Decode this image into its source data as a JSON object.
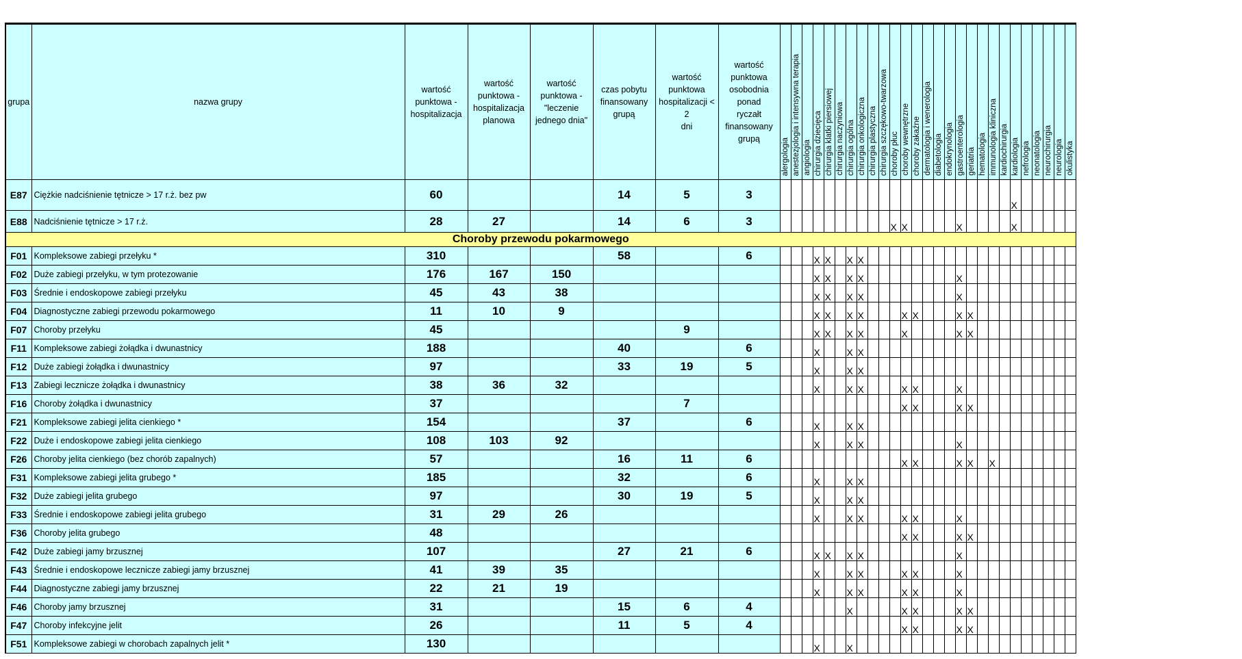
{
  "headers": {
    "code": "grupa",
    "name": "nazwa grupy",
    "values": [
      [
        "wartość",
        "punktowa -",
        "hospitalizacja"
      ],
      [
        "wartość",
        "punktowa -",
        "hospitalizacja",
        "planowa"
      ],
      [
        "wartość",
        "punktowa -",
        "\"leczenie",
        "jednego dnia\""
      ],
      [
        "czas pobytu",
        "finansowany",
        "grupą"
      ],
      [
        "wartość",
        "punktowa",
        "hospitalizacji < 2",
        "dni"
      ],
      [
        "wartość",
        "punktowa",
        "osobodnia ponad",
        "ryczałt",
        "finansowany",
        "grupą"
      ]
    ],
    "specialties": [
      "alergologia",
      "anestezjologia i intensywna terapia",
      "angiologia",
      "chirurgia dziecięca",
      "chirurgia klatki piersiowej",
      "chirurgia naczyniowa",
      "chirurgia ogólna",
      "chirurgia onkologiczna",
      "chirurgia plastyczna",
      "chirurgia szczękowo-twarzowa",
      "choroby płuc",
      "choroby wewnętrzne",
      "choroby zakaźne",
      "dermatologia i wenerologia",
      "diabetologia",
      "endokrynologia",
      "gastroenterologia",
      "geriatria",
      "hematologia",
      "immunologia kliniczna",
      "kardiochirurgia",
      "kardiologia",
      "nefrologia",
      "neonatologia",
      "neurochirurgia",
      "neurologia",
      "okulistyka"
    ]
  },
  "mark": "X",
  "rows": [
    {
      "code": "E87",
      "name": "Ciężkie nadciśnienie tętnicze > 17 r.ż. bez pw",
      "values": [
        "60",
        "",
        "",
        "14",
        "5",
        "3"
      ],
      "marks": [
        21
      ]
    },
    {
      "code": "E88",
      "name": "Nadciśnienie tętnicze > 17 r.ż.",
      "values": [
        "28",
        "27",
        "",
        "14",
        "6",
        "3"
      ],
      "marks": [
        10,
        11,
        16,
        21
      ]
    },
    {
      "section": "Choroby przewodu pokarmowego"
    },
    {
      "code": "F01",
      "name": "Kompleksowe zabiegi przełyku *",
      "values": [
        "310",
        "",
        "",
        "58",
        "",
        "6"
      ],
      "marks": [
        3,
        4,
        6,
        7
      ]
    },
    {
      "code": "F02",
      "name": "Duże zabiegi przełyku, w tym protezowanie",
      "values": [
        "176",
        "167",
        "150",
        "",
        "",
        ""
      ],
      "marks": [
        3,
        4,
        6,
        7,
        16
      ]
    },
    {
      "code": "F03",
      "name": "Średnie i endoskopowe zabiegi przełyku",
      "values": [
        "45",
        "43",
        "38",
        "",
        "",
        ""
      ],
      "marks": [
        3,
        4,
        6,
        7,
        16
      ]
    },
    {
      "code": "F04",
      "name": "Diagnostyczne zabiegi przewodu pokarmowego",
      "values": [
        "11",
        "10",
        "9",
        "",
        "",
        ""
      ],
      "marks": [
        3,
        4,
        6,
        7,
        11,
        12,
        16,
        17
      ]
    },
    {
      "code": "F07",
      "name": "Choroby przełyku",
      "values": [
        "45",
        "",
        "",
        "",
        "9",
        ""
      ],
      "marks": [
        3,
        4,
        6,
        7,
        11,
        16,
        17
      ]
    },
    {
      "code": "F11",
      "name": "Kompleksowe zabiegi żołądka i dwunastnicy",
      "values": [
        "188",
        "",
        "",
        "40",
        "",
        "6"
      ],
      "marks": [
        3,
        6,
        7
      ]
    },
    {
      "code": "F12",
      "name": "Duże zabiegi żołądka i dwunastnicy",
      "values": [
        "97",
        "",
        "",
        "33",
        "19",
        "5"
      ],
      "marks": [
        3,
        6,
        7
      ]
    },
    {
      "code": "F13",
      "name": "Zabiegi lecznicze żołądka i dwunastnicy",
      "values": [
        "38",
        "36",
        "32",
        "",
        "",
        ""
      ],
      "marks": [
        3,
        6,
        7,
        11,
        12,
        16
      ]
    },
    {
      "code": "F16",
      "name": "Choroby żołądka i dwunastnicy",
      "values": [
        "37",
        "",
        "",
        "",
        "7",
        ""
      ],
      "marks": [
        11,
        12,
        16,
        17
      ]
    },
    {
      "code": "F21",
      "name": "Kompleksowe zabiegi jelita cienkiego *",
      "values": [
        "154",
        "",
        "",
        "37",
        "",
        "6"
      ],
      "marks": [
        3,
        6,
        7
      ]
    },
    {
      "code": "F22",
      "name": "Duże i endoskopowe zabiegi jelita cienkiego",
      "values": [
        "108",
        "103",
        "92",
        "",
        "",
        ""
      ],
      "marks": [
        3,
        6,
        7,
        16
      ]
    },
    {
      "code": "F26",
      "name": "Choroby jelita cienkiego (bez chorób zapalnych)",
      "values": [
        "57",
        "",
        "",
        "16",
        "11",
        "6"
      ],
      "marks": [
        11,
        12,
        16,
        17,
        19
      ]
    },
    {
      "code": "F31",
      "name": "Kompleksowe zabiegi jelita grubego *",
      "values": [
        "185",
        "",
        "",
        "32",
        "",
        "6"
      ],
      "marks": [
        3,
        6,
        7
      ]
    },
    {
      "code": "F32",
      "name": "Duże zabiegi jelita grubego",
      "values": [
        "97",
        "",
        "",
        "30",
        "19",
        "5"
      ],
      "marks": [
        3,
        6,
        7
      ]
    },
    {
      "code": "F33",
      "name": "Średnie i endoskopowe zabiegi jelita grubego",
      "values": [
        "31",
        "29",
        "26",
        "",
        "",
        ""
      ],
      "marks": [
        3,
        6,
        7,
        11,
        12,
        16
      ]
    },
    {
      "code": "F36",
      "name": "Choroby jelita grubego",
      "values": [
        "48",
        "",
        "",
        "",
        "",
        ""
      ],
      "marks": [
        11,
        12,
        16,
        17
      ]
    },
    {
      "code": "F42",
      "name": "Duże zabiegi jamy brzusznej",
      "values": [
        "107",
        "",
        "",
        "27",
        "21",
        "6"
      ],
      "marks": [
        3,
        4,
        6,
        7,
        16
      ]
    },
    {
      "code": "F43",
      "name": "Średnie i endoskopowe lecznicze zabiegi jamy brzusznej",
      "values": [
        "41",
        "39",
        "35",
        "",
        "",
        ""
      ],
      "marks": [
        3,
        6,
        7,
        11,
        12,
        16
      ]
    },
    {
      "code": "F44",
      "name": "Diagnostyczne zabiegi jamy brzusznej",
      "values": [
        "22",
        "21",
        "19",
        "",
        "",
        ""
      ],
      "marks": [
        3,
        6,
        7,
        11,
        12,
        16
      ]
    },
    {
      "code": "F46",
      "name": "Choroby jamy brzusznej",
      "values": [
        "31",
        "",
        "",
        "15",
        "6",
        "4"
      ],
      "marks": [
        6,
        11,
        12,
        16,
        17
      ]
    },
    {
      "code": "F47",
      "name": "Choroby infekcyjne jelit",
      "values": [
        "26",
        "",
        "",
        "11",
        "5",
        "4"
      ],
      "marks": [
        11,
        12,
        16,
        17
      ]
    },
    {
      "code": "F51",
      "name": "Kompleksowe zabiegi w chorobach zapalnych jelit *",
      "values": [
        "130",
        "",
        "",
        "",
        "",
        ""
      ],
      "marks": [
        3,
        6
      ]
    }
  ]
}
